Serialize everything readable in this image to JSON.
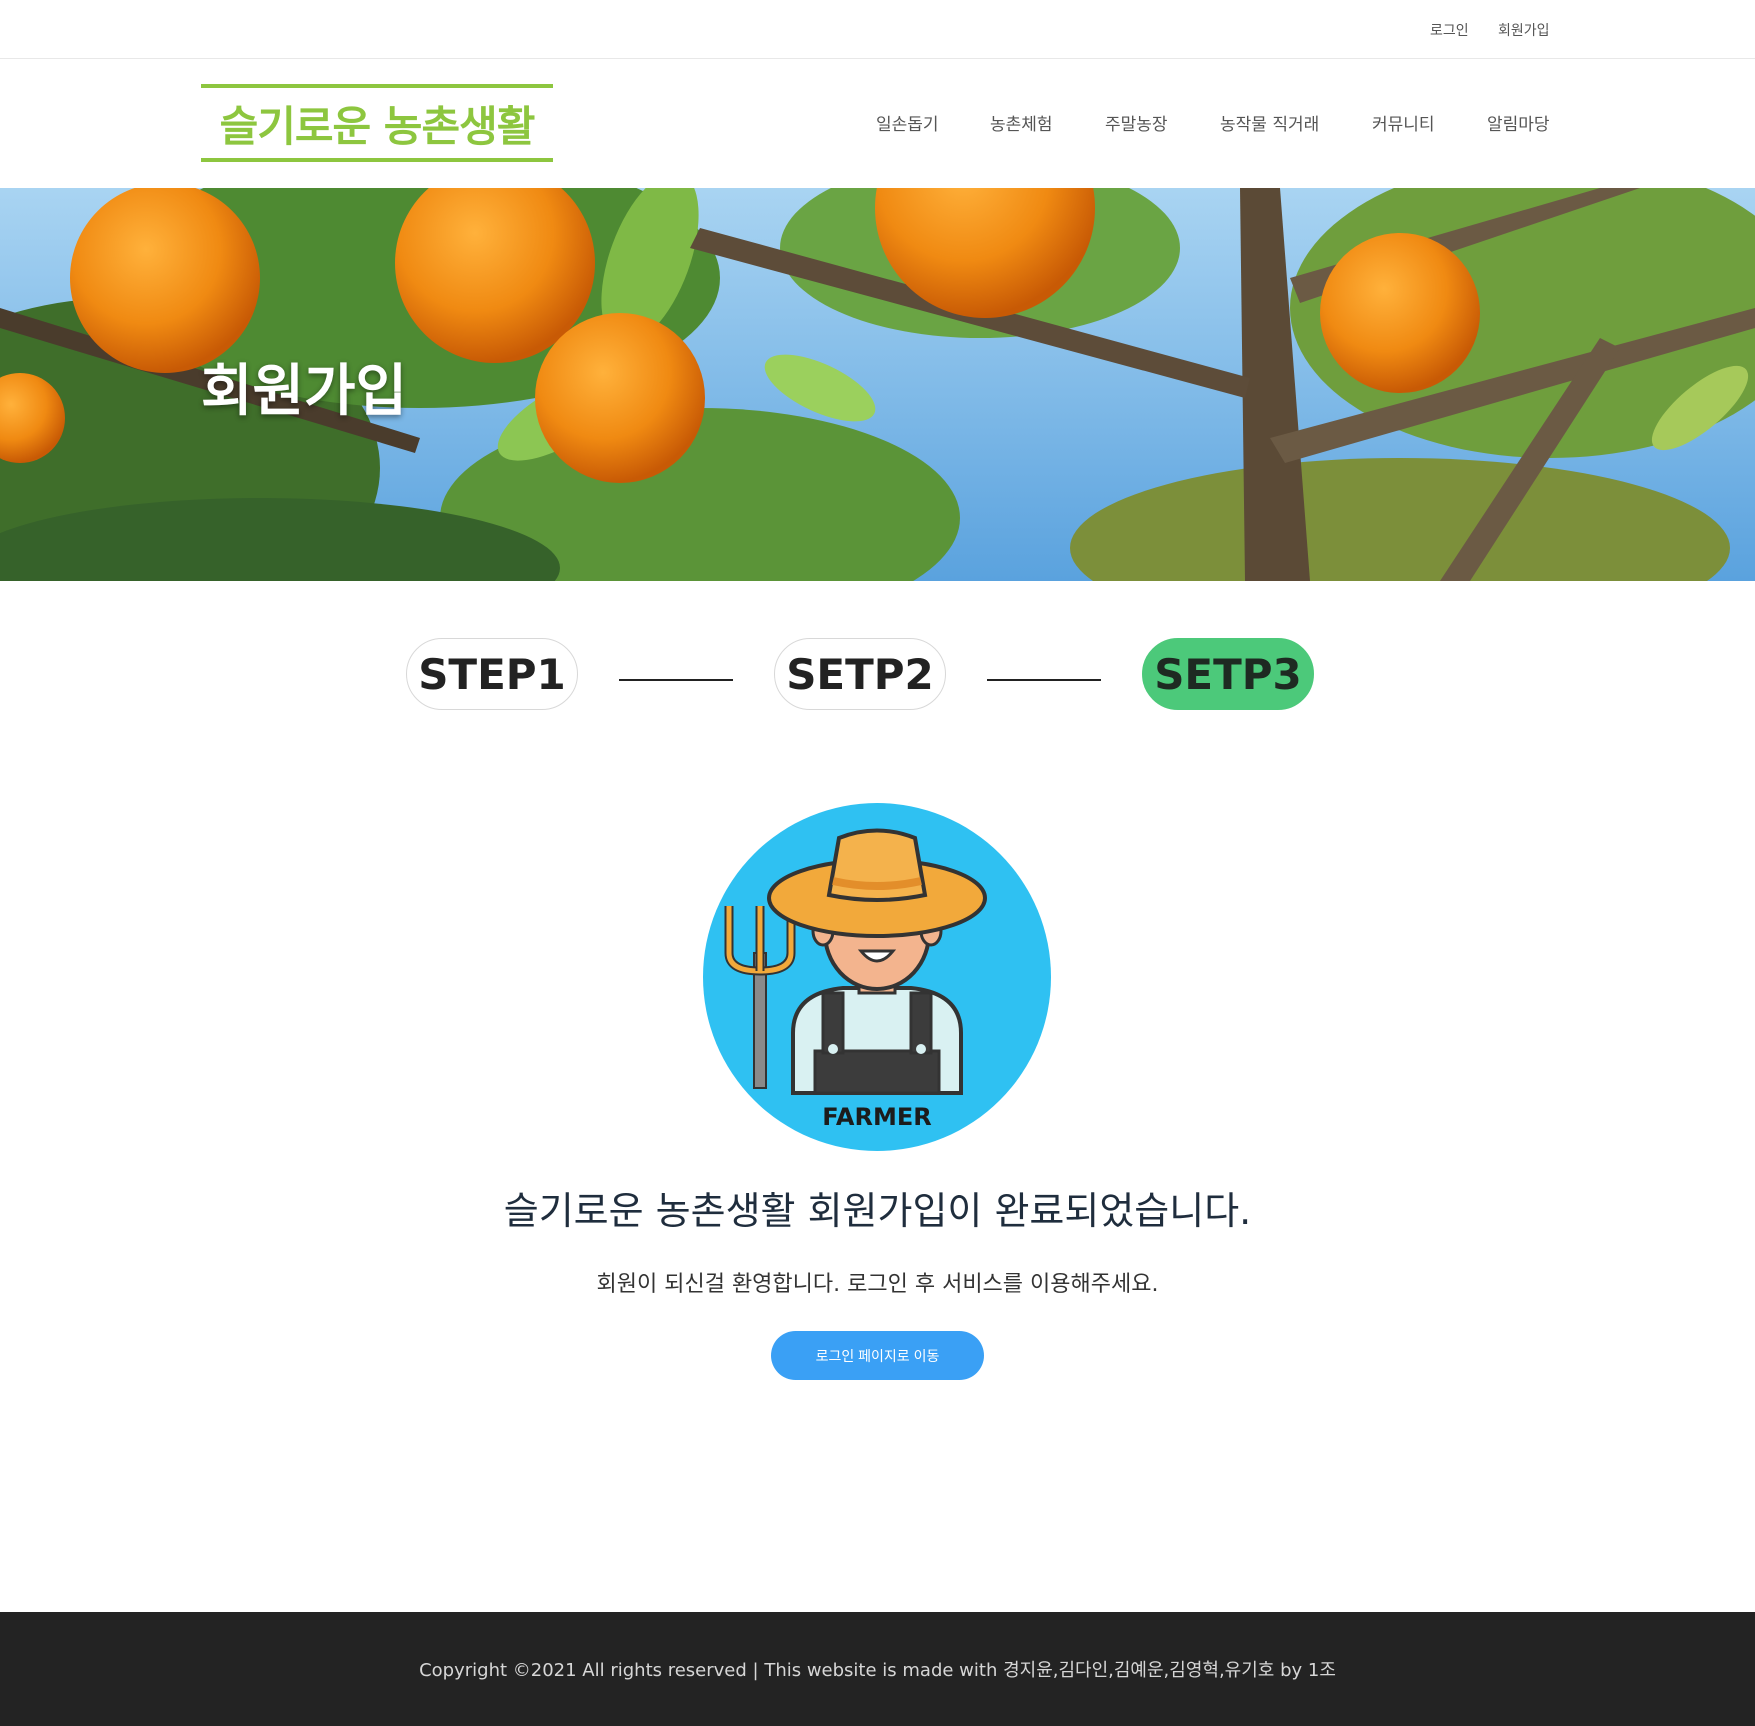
{
  "topbar": {
    "login_label": "로그인",
    "signup_label": "회원가입"
  },
  "header": {
    "logo_text": "슬기로운 농촌생활",
    "nav": [
      "일손돕기",
      "농촌체험",
      "주말농장",
      "농작물 직거래",
      "커뮤니티",
      "알림마당"
    ]
  },
  "hero": {
    "title": "회원가입"
  },
  "steps": {
    "items": [
      "STEP1",
      "SETP2",
      "SETP3"
    ],
    "active_index": 2,
    "active_color": "#4cc97a"
  },
  "illustration": {
    "caption": "FARMER",
    "icon": "farmer-icon",
    "background_color": "#2fc1f2"
  },
  "completion": {
    "title": "슬기로운 농촌생활 회원가입이 완료되었습니다.",
    "subtitle": "회원이 되신걸 환영합니다. 로그인 후 서비스를 이용해주세요.",
    "button_label": "로그인 페이지로 이동",
    "button_color": "#3aa0f5"
  },
  "footer": {
    "copyright": "Copyright ©2021 All rights reserved | This website is made with 경지윤,김다인,김예운,김영혁,유기호 by 1조"
  },
  "colors": {
    "brand_green": "#8dc63f",
    "footer_bg": "#232323"
  }
}
